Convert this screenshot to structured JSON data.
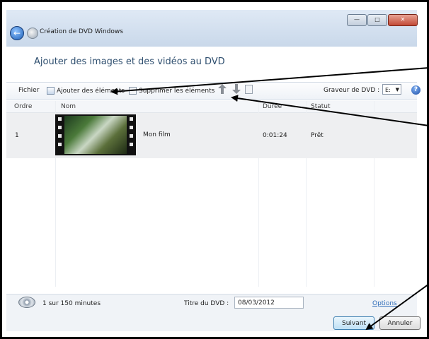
{
  "window": {
    "title": "Création de DVD Windows",
    "controls": {
      "minimize": "—",
      "maximize": "□",
      "close": "✕"
    }
  },
  "heading": "Ajouter des images et des vidéos au DVD",
  "toolbar": {
    "file_menu": "Fichier",
    "add_items": "Ajouter des éléments",
    "remove_items": "Supprimer les éléments",
    "burner_label": "Graveur de DVD :",
    "burner_value": "E:",
    "help": "?"
  },
  "table": {
    "headers": [
      "Ordre",
      "Nom",
      "Durée",
      "Statut"
    ],
    "rows": [
      {
        "order": "1",
        "name": "Mon film",
        "duration": "0:01:24",
        "status": "Prêt"
      }
    ]
  },
  "status": {
    "usage": "1 sur 150 minutes",
    "dvd_title_label": "Titre du DVD :",
    "dvd_title_value": "08/03/2012",
    "options_link": "Options"
  },
  "buttons": {
    "next": "Suivant",
    "cancel": "Annuler"
  },
  "colors": {
    "accent": "#2e6bb8",
    "heading": "#2f4f6f",
    "selected_row": "#eeeff1"
  }
}
